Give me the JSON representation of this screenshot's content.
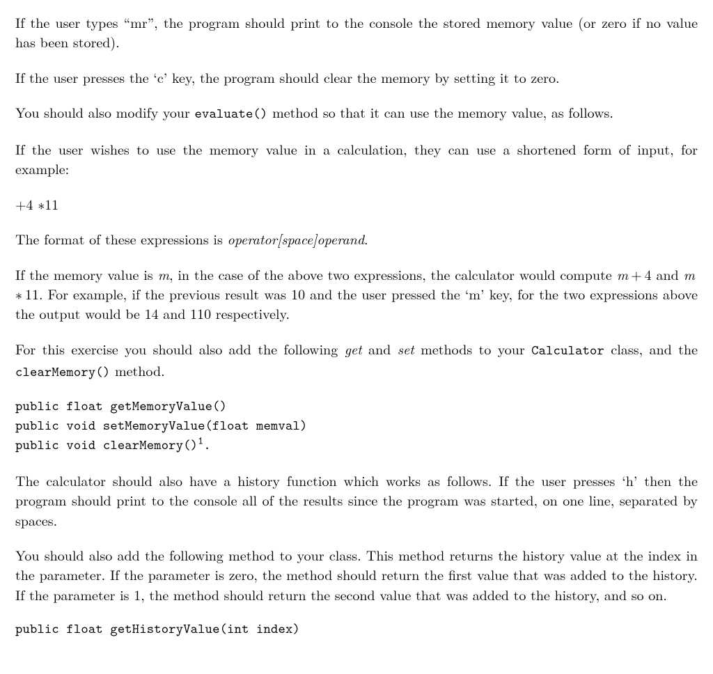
{
  "p1": {
    "a": "If the user types “mr”, the program should print to the console the stored memory value (or zero if no value has been stored)."
  },
  "p2": {
    "a": "If the user presses the ‘c’ key, the program should clear the memory by setting it to zero."
  },
  "p3": {
    "a": "You should also modify your ",
    "code1": "evaluate()",
    "b": " method so that it can use the memory value, as follows."
  },
  "p4": {
    "a": "If the user wishes to use the memory value in a calculation, they can use a shortened form of input, for example:"
  },
  "expr": {
    "l1": "+4",
    "l2": "∗11"
  },
  "p5": {
    "a": "The format of these expressions is ",
    "it1": "operator[space]operand",
    "b": "."
  },
  "p6": {
    "a": "If the memory value is ",
    "m": "m",
    "b": ", in the case of the above two expressions, the calculator would compute ",
    "expr1_l": "m",
    "expr1_op": " + 4",
    "c": " and ",
    "expr2_l": "m",
    "expr2_op": " ∗ 11",
    "d": ". For example, if the previous result was 10 and the user pressed the ‘m’ key, for the two expressions above the output would be 14 and 110 respectively."
  },
  "p7": {
    "a": "For this exercise you should also add the following ",
    "it1": "get",
    "b": " and ",
    "it2": "set",
    "c": " methods to your ",
    "code1": "Calculator",
    "d": " class, and the ",
    "code2": "clearMemory()",
    "e": " method."
  },
  "code1": {
    "l1": "public float getMemoryValue()",
    "l2": "public void setMemoryValue(float memval)",
    "l3": "public void clearMemory()",
    "fn": "1",
    "l3b": "."
  },
  "p8": {
    "a": "The calculator should also have a history function which works as follows. If the user presses ‘h’ then the program should print to the console all of the results since the program was started, on one line, separated by spaces."
  },
  "p9": {
    "a": "You should also add the following method to your class. This method returns the history value at the index in the parameter. If the parameter is zero, the method should return the first value that was added to the history. If the parameter is 1, the method should return the second value that was added to the history, and so on."
  },
  "code2": {
    "l1": "public float getHistoryValue(int index)"
  }
}
